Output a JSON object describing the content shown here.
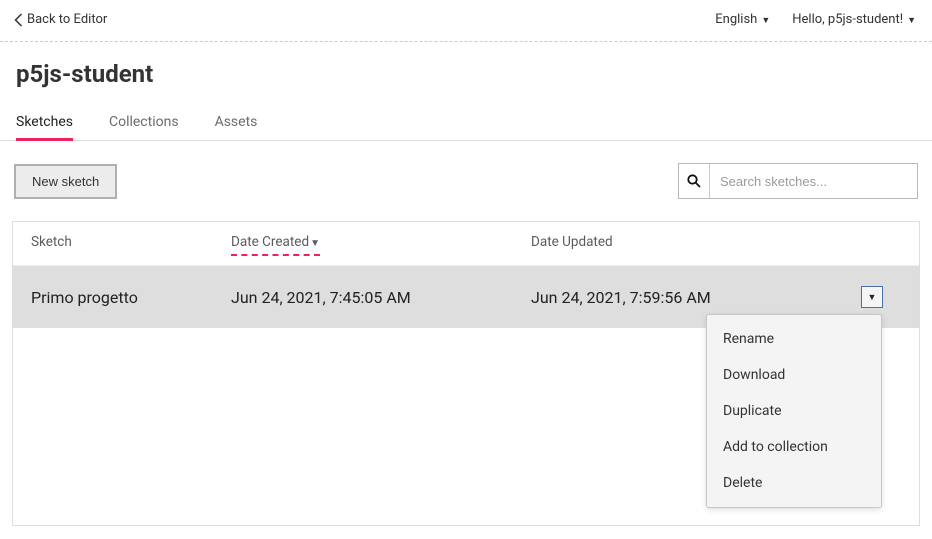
{
  "topbar": {
    "back_label": "Back to Editor",
    "language_label": "English",
    "greeting": "Hello, p5js-student!"
  },
  "page": {
    "title": "p5js-student"
  },
  "tabs": {
    "sketches": "Sketches",
    "collections": "Collections",
    "assets": "Assets"
  },
  "buttons": {
    "new_sketch": "New sketch"
  },
  "search": {
    "placeholder": "Search sketches..."
  },
  "table": {
    "headers": {
      "sketch": "Sketch",
      "date_created": "Date Created",
      "date_updated": "Date Updated"
    },
    "rows": [
      {
        "name": "Primo progetto",
        "created": "Jun 24, 2021, 7:45:05 AM",
        "updated": "Jun 24, 2021, 7:59:56 AM"
      }
    ]
  },
  "dropdown": {
    "rename": "Rename",
    "download": "Download",
    "duplicate": "Duplicate",
    "add_to_collection": "Add to collection",
    "delete": "Delete"
  }
}
